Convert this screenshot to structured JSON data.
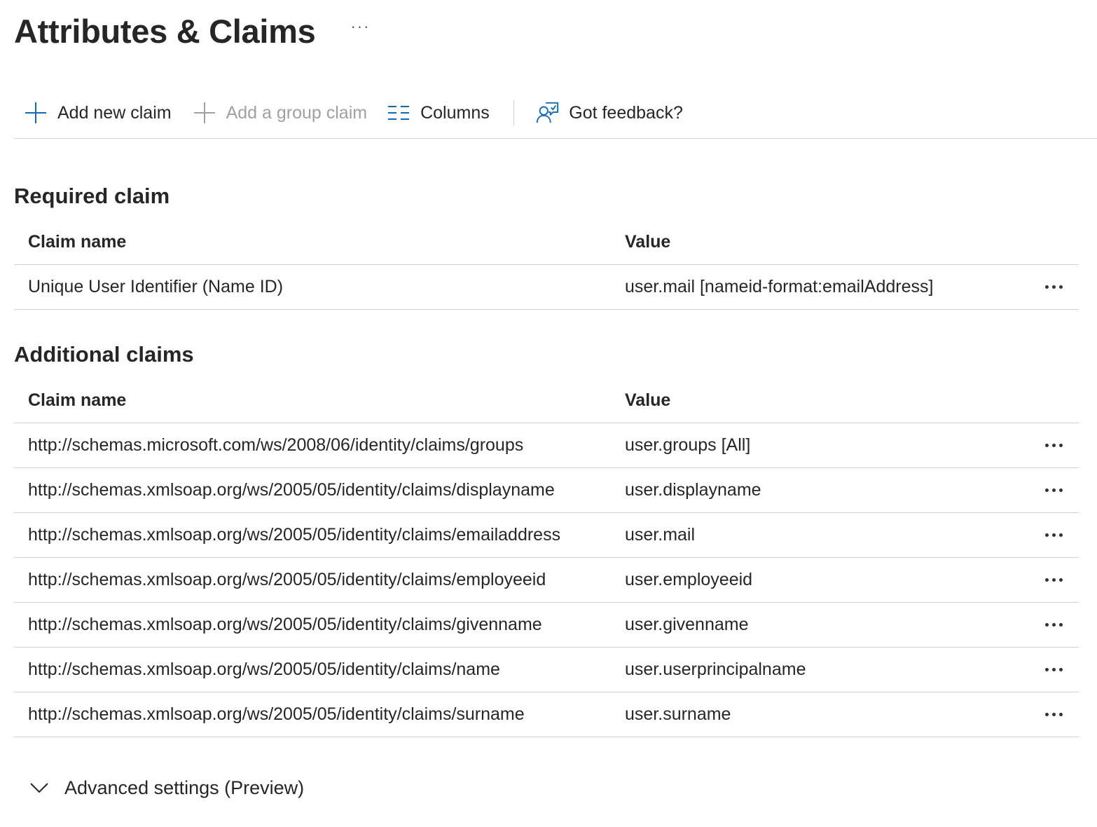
{
  "header": {
    "title": "Attributes & Claims",
    "more_label": "···"
  },
  "toolbar": {
    "add_claim_label": "Add new claim",
    "add_group_label": "Add a group claim",
    "columns_label": "Columns",
    "feedback_label": "Got feedback?"
  },
  "required": {
    "title": "Required claim",
    "columns": {
      "name": "Claim name",
      "value": "Value"
    },
    "rows": [
      {
        "name": "Unique User Identifier (Name ID)",
        "value": "user.mail [nameid-format:emailAddress]"
      }
    ]
  },
  "additional": {
    "title": "Additional claims",
    "columns": {
      "name": "Claim name",
      "value": "Value"
    },
    "rows": [
      {
        "name": "http://schemas.microsoft.com/ws/2008/06/identity/claims/groups",
        "value": "user.groups [All]"
      },
      {
        "name": "http://schemas.xmlsoap.org/ws/2005/05/identity/claims/displayname",
        "value": "user.displayname"
      },
      {
        "name": "http://schemas.xmlsoap.org/ws/2005/05/identity/claims/emailaddress",
        "value": "user.mail"
      },
      {
        "name": "http://schemas.xmlsoap.org/ws/2005/05/identity/claims/employeeid",
        "value": "user.employeeid"
      },
      {
        "name": "http://schemas.xmlsoap.org/ws/2005/05/identity/claims/givenname",
        "value": "user.givenname"
      },
      {
        "name": "http://schemas.xmlsoap.org/ws/2005/05/identity/claims/name",
        "value": "user.userprincipalname"
      },
      {
        "name": "http://schemas.xmlsoap.org/ws/2005/05/identity/claims/surname",
        "value": "user.surname"
      }
    ]
  },
  "advanced": {
    "label": "Advanced settings (Preview)"
  },
  "colors": {
    "accent": "#0f6cbd",
    "text": "#262626",
    "disabled": "#a0a0a0",
    "divider": "#d2d2d2"
  },
  "icons": {
    "add": "plus-icon",
    "add_group": "plus-icon",
    "columns": "columns-icon",
    "feedback": "feedback-icon",
    "more": "more-icon",
    "expand": "chevron-down-icon"
  }
}
